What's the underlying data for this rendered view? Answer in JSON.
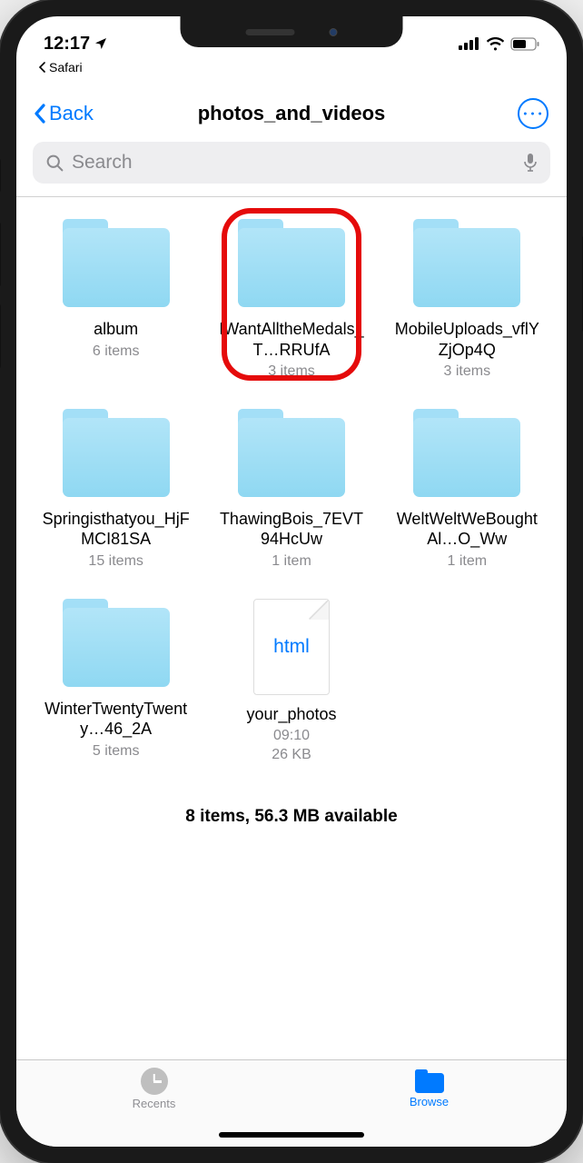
{
  "status": {
    "time": "12:17",
    "breadcrumb_app": "Safari"
  },
  "nav": {
    "back_label": "Back",
    "title": "photos_and_videos"
  },
  "search": {
    "placeholder": "Search"
  },
  "items": [
    {
      "type": "folder",
      "name": "album",
      "meta": "6 items",
      "highlighted": false
    },
    {
      "type": "folder",
      "name": "IWantAlltheMedals_T…RRUfA",
      "meta": "3 items",
      "highlighted": true
    },
    {
      "type": "folder",
      "name": "MobileUploads_vflYZjOp4Q",
      "meta": "3 items",
      "highlighted": false
    },
    {
      "type": "folder",
      "name": "Springisthatyou_HjFMCI81SA",
      "meta": "15 items",
      "highlighted": false
    },
    {
      "type": "folder",
      "name": "ThawingBois_7EVT94HcUw",
      "meta": "1 item",
      "highlighted": false
    },
    {
      "type": "folder",
      "name": "WeltWeltWeBoughtAl…O_Ww",
      "meta": "1 item",
      "highlighted": false
    },
    {
      "type": "folder",
      "name": "WinterTwentyTwenty…46_2A",
      "meta": "5 items",
      "highlighted": false
    },
    {
      "type": "file",
      "badge": "html",
      "name": "your_photos",
      "meta": "09:10\n26 KB",
      "highlighted": false
    }
  ],
  "summary": "8 items, 56.3 MB available",
  "tabs": {
    "recents_label": "Recents",
    "browse_label": "Browse",
    "active": "browse"
  }
}
